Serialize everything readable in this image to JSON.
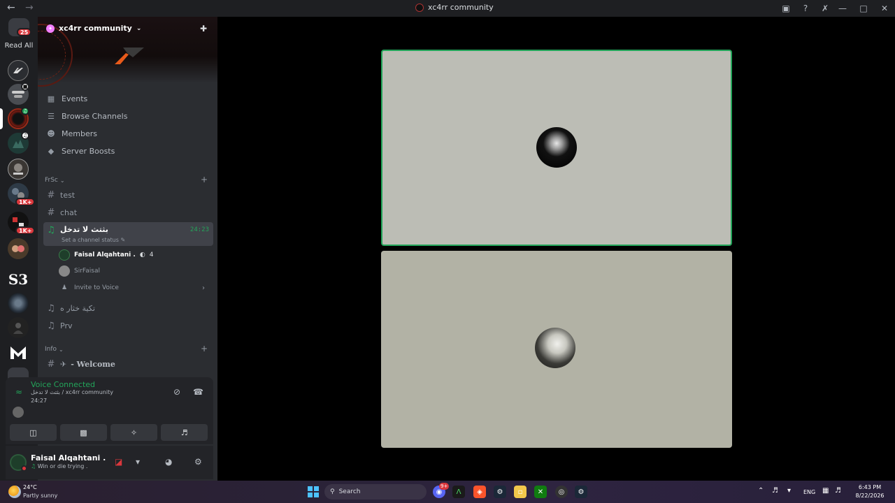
{
  "window": {
    "title": "xc4rr community"
  },
  "rail": {
    "read_all_label": "Read All",
    "read_all_badge": "25",
    "servers": [
      {
        "name": "server-1",
        "badge": ""
      },
      {
        "name": "server-2",
        "badge": ""
      },
      {
        "name": "server-xc4rr",
        "badge": ""
      },
      {
        "name": "server-4",
        "badge": ""
      },
      {
        "name": "server-5",
        "badge": ""
      },
      {
        "name": "server-6",
        "badge": "1K+"
      },
      {
        "name": "server-7",
        "badge": "1K+"
      },
      {
        "name": "server-8",
        "badge": ""
      },
      {
        "name": "server-s3",
        "label": "S3",
        "badge": ""
      },
      {
        "name": "server-10",
        "badge": ""
      },
      {
        "name": "server-11",
        "badge": ""
      },
      {
        "name": "server-m",
        "badge": ""
      }
    ]
  },
  "sidebar": {
    "server_name": "xc4rr community",
    "nav": [
      {
        "label": "Events",
        "icon": "calendar-icon"
      },
      {
        "label": "Browse Channels",
        "icon": "list-icon"
      },
      {
        "label": "Members",
        "icon": "members-icon"
      },
      {
        "label": "Server Boosts",
        "icon": "boost-icon"
      }
    ],
    "categories": {
      "frsc": "FrSc",
      "info": "Info"
    },
    "channels": {
      "test": "test",
      "chat": "chat",
      "voice_active": "بثتث لا تدخل",
      "voice_active_time": "24:23",
      "voice_active_status": "Set a channel status",
      "voice_2": "تكية خثار ه",
      "voice_3": "Prv",
      "welcome": "- Welcome"
    },
    "voice_users": [
      {
        "name": "Faisal Alqahtani .",
        "stream_count": "4"
      },
      {
        "name": "SirFaisal"
      }
    ],
    "invite_label": "Invite to Voice"
  },
  "voice_panel": {
    "title": "Voice Connected",
    "subtitle": "بثتث لا تدخل / xc4rr community",
    "time": "24:27"
  },
  "user_panel": {
    "name": "Faisal Alqahtani .",
    "status": "Win or die trying ."
  },
  "taskbar": {
    "temperature": "24°C",
    "condition": "Partly sunny",
    "search_placeholder": "Search",
    "discord_badge": "9+",
    "language": "ENG",
    "time": "6:43 PM",
    "date": "8/22/2026"
  },
  "colors": {
    "accent_green": "#23a55a",
    "badge_red": "#da373c",
    "sidebar_bg": "#2b2d31",
    "rail_bg": "#1e1f22"
  }
}
